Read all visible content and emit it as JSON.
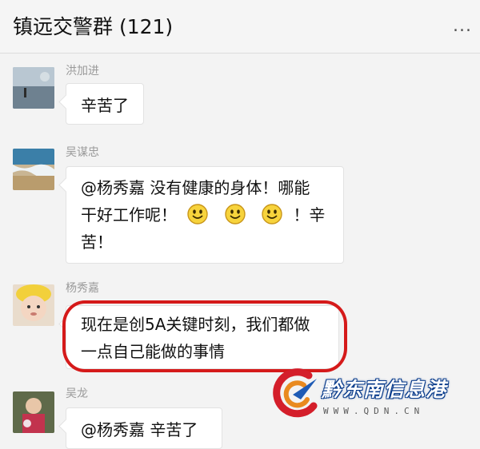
{
  "header": {
    "title": "镇远交警群 (121)",
    "more_label": "..."
  },
  "messages": [
    {
      "sender": "洪加进",
      "lines": [
        "辛苦了"
      ]
    },
    {
      "sender": "吴谋忠",
      "lines": [
        "@杨秀嘉 没有健康的身体！哪能",
        "干好工作呢！",
        "！辛",
        "苦！"
      ]
    },
    {
      "sender": "杨秀嘉",
      "lines": [
        "现在是创5A关键时刻，我们都做",
        "一点自己能做的事情"
      ]
    },
    {
      "sender": "吴龙",
      "lines": [
        "@杨秀嘉 辛苦了"
      ]
    }
  ],
  "watermark": {
    "name": "黔东南信息港",
    "url": "WWW.QDN.CN"
  },
  "colors": {
    "highlight": "#d51a1a",
    "background": "#f3f3f3"
  }
}
